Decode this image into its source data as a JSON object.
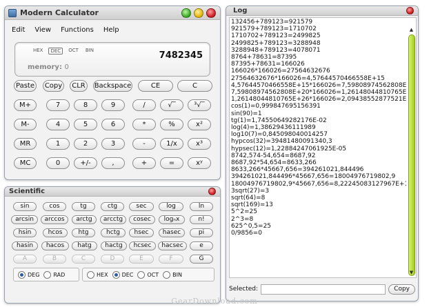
{
  "calculator": {
    "title": "Modern Calculator",
    "menu": [
      "Edit",
      "View",
      "Functions",
      "Help"
    ],
    "display": {
      "bases": [
        "HEX",
        "DEC",
        "OCT",
        "BIN"
      ],
      "selected_base": "DEC",
      "value": "7482345",
      "memory_label": "memory:",
      "memory_value": "0"
    },
    "rows": [
      [
        "Paste",
        "Copy",
        "CLR",
        "Backspace",
        "CE",
        "C"
      ],
      [
        "M+",
        "7",
        "8",
        "9",
        "/",
        "√‾",
        "³√‾"
      ],
      [
        "M-",
        "4",
        "5",
        "6",
        "*",
        "%",
        "x²"
      ],
      [
        "MR",
        "1",
        "2",
        "3",
        "-",
        "1/x",
        "x³"
      ],
      [
        "MC",
        "0",
        "+/-",
        ",",
        "+",
        "=",
        "xʸ"
      ]
    ]
  },
  "scientific": {
    "title": "Scientific",
    "rows": [
      [
        "sin",
        "cos",
        "tg",
        "ctg",
        "sec",
        "log",
        "ln"
      ],
      [
        "arcsin",
        "arccos",
        "arctg",
        "arcctg",
        "cosec",
        "logₙx",
        "n!"
      ],
      [
        "hsin",
        "hcos",
        "htg",
        "hctg",
        "hsec",
        "hasec",
        "pi"
      ],
      [
        "hasin",
        "hacos",
        "hatg",
        "hactg",
        "hcsec",
        "hacsec",
        "e"
      ],
      [
        "A",
        "B",
        "C",
        "D",
        "E",
        "F",
        "G"
      ]
    ],
    "radio_groups": [
      [
        {
          "label": "DEG",
          "checked": true
        },
        {
          "label": "RAD",
          "checked": false
        }
      ],
      [
        {
          "label": "HEX",
          "checked": false
        },
        {
          "label": "DEC",
          "checked": true
        },
        {
          "label": "OCT",
          "checked": false
        },
        {
          "label": "BIN",
          "checked": false
        }
      ]
    ]
  },
  "log": {
    "title": "Log",
    "lines": [
      "132456+789123=921579",
      "921579+789123=1710702",
      "1710702+789123=2499825",
      "2499825+789123=3288948",
      "3288948+789123=4078071",
      "8764+78631=87395",
      "87395+78631=166026",
      "166026*166026=27564632676",
      "27564632676*166026=4,57644570466558E+15",
      "4,57644570466558E+15*166026=7,59808974562808E+20",
      "7,59808974562808E+20*166026=1,26148044810765E+26",
      "1,26148044810765E+26*166026=2,09438552877521E+31",
      "cos(1)=0,999847695156391",
      "sin(90)=1",
      "tg(1)=1,74550649282176E-02",
      "log(4)=1,38629436111989",
      "log10(7)=0,845098040014257",
      "hypcos(32)=39481480091340,3",
      "hypsec(12)=1,22884247061925E-05",
      "8742,574-54,654=8687,92",
      "8687,92*54,654=8633,266",
      "8633,266*45667,656=394261021,844496",
      "394261021,844496*45667,656=18004976719802,9",
      "18004976719802,9*45667,656=8,22245083127967E+17",
      "3sqrt(27)=3",
      "sqrt(64)=8",
      "sqrt(169)=13",
      "5^2=25",
      "2^3=8",
      "625^0,5=25",
      "0/9856=0"
    ],
    "selected_label": "Selected:",
    "selected_value": "",
    "copy_label": "Copy"
  },
  "watermark": "GearDownload.com"
}
